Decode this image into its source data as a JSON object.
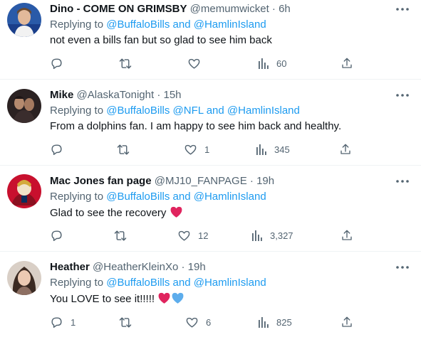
{
  "replies": [
    {
      "display_name": "Dino - COME ON GRIMSBY",
      "handle": "@memumwicket",
      "separator": "·",
      "time": "6h",
      "replying_prefix": "Replying to",
      "mention_text": "@BuffaloBills and @HamlinIsland",
      "text": "not even a bills fan but so glad to see him back",
      "emoji": [],
      "reply_count": "",
      "retweet_count": "",
      "like_count": "",
      "view_count": "60"
    },
    {
      "display_name": "Mike",
      "handle": "@AlaskaTonight",
      "separator": "·",
      "time": "15h",
      "replying_prefix": "Replying to",
      "mention_text": "@BuffaloBills @NFL and @HamlinIsland",
      "text": "From a dolphins fan. I am happy to see him back and healthy.",
      "emoji": [],
      "reply_count": "",
      "retweet_count": "",
      "like_count": "1",
      "view_count": "345"
    },
    {
      "display_name": "Mac Jones fan page",
      "handle": "@MJ10_FANPAGE",
      "separator": "·",
      "time": "19h",
      "replying_prefix": "Replying to",
      "mention_text": "@BuffaloBills and @HamlinIsland",
      "text": "Glad to see the recovery",
      "emoji": [
        "red-heart"
      ],
      "reply_count": "",
      "retweet_count": "",
      "like_count": "12",
      "view_count": "3,327"
    },
    {
      "display_name": "Heather",
      "handle": "@HeatherKleinXo",
      "separator": "·",
      "time": "19h",
      "replying_prefix": "Replying to",
      "mention_text": "@BuffaloBills and @HamlinIsland",
      "text": "You LOVE to see it!!!!!",
      "emoji": [
        "red-heart",
        "blue-heart"
      ],
      "reply_count": "1",
      "retweet_count": "",
      "like_count": "6",
      "view_count": "825"
    }
  ],
  "icons": {
    "more": "more-horizontal-icon",
    "reply": "reply-bubble-icon",
    "retweet": "retweet-icon",
    "like": "heart-outline-icon",
    "views": "analytics-bars-icon",
    "share": "share-upload-icon"
  },
  "colors": {
    "text_primary": "#0f1419",
    "text_secondary": "#536471",
    "link": "#1d9bf0",
    "divider": "#eff3f4",
    "heart_red": "#e0245e",
    "heart_blue": "#5dadec"
  }
}
